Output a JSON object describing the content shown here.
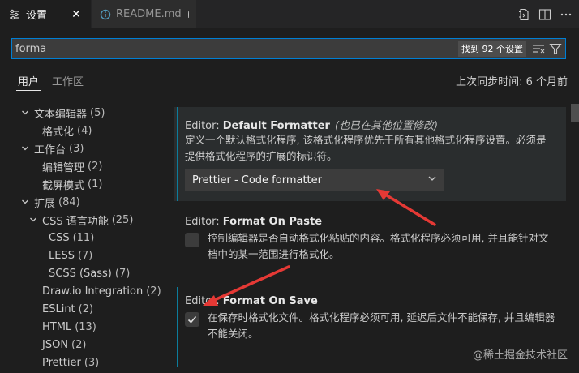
{
  "tabs": [
    {
      "label": "设置",
      "icon": "settings-list-icon",
      "state": "active"
    },
    {
      "label": "README.md",
      "icon": "info-icon",
      "state": "unsaved"
    }
  ],
  "editor_actions": [
    "open-settings-json-icon",
    "split-editor-icon",
    "more-actions-icon"
  ],
  "search": {
    "value": "forma",
    "result_count": "找到 92 个设置",
    "buttons": [
      "clear-filter-icon",
      "filter-icon"
    ]
  },
  "scope": {
    "tabs": [
      "用户",
      "工作区"
    ],
    "active": "用户",
    "sync_status": "上次同步时间: 6 个月前"
  },
  "toc": [
    {
      "label": "文本编辑器",
      "count": "(5)",
      "level": 0,
      "expanded": true
    },
    {
      "label": "格式化",
      "count": "(4)",
      "level": 1
    },
    {
      "label": "工作台",
      "count": "(3)",
      "level": 0,
      "expanded": true
    },
    {
      "label": "编辑管理",
      "count": "(2)",
      "level": 1
    },
    {
      "label": "截屏模式",
      "count": "(1)",
      "level": 1
    },
    {
      "label": "扩展",
      "count": "(84)",
      "level": 0,
      "expanded": true
    },
    {
      "label": "CSS 语言功能",
      "count": "(25)",
      "level": 1,
      "expanded": true
    },
    {
      "label": "CSS",
      "count": "(11)",
      "level": 2
    },
    {
      "label": "LESS",
      "count": "(7)",
      "level": 2
    },
    {
      "label": "SCSS (Sass)",
      "count": "(7)",
      "level": 2
    },
    {
      "label": "Draw.io Integration",
      "count": "(2)",
      "level": 1
    },
    {
      "label": "ESLint",
      "count": "(2)",
      "level": 1
    },
    {
      "label": "HTML",
      "count": "(13)",
      "level": 1
    },
    {
      "label": "JSON",
      "count": "(2)",
      "level": 1
    },
    {
      "label": "Prettier",
      "count": "(3)",
      "level": 1
    }
  ],
  "settings": {
    "default_formatter": {
      "category": "Editor: ",
      "name": "Default Formatter",
      "note": "(也已在其他位置修改)",
      "description": "定义一个默认格式化程序, 该格式化程序优先于所有其他格式化程序设置。必须是提供格式化程序的扩展的标识符。",
      "value": "Prettier - Code formatter"
    },
    "format_on_paste": {
      "category": "Editor: ",
      "name": "Format On Paste",
      "description": "控制编辑器是否自动格式化粘贴的内容。格式化程序必须可用, 并且能针对文档中的某一范围进行格式化。",
      "checked": false
    },
    "format_on_save": {
      "category": "Editor: ",
      "name": "Format On Save",
      "description": "在保存时格式化文件。格式化程序必须可用, 延迟后文件不能保存, 并且编辑器不能关闭。",
      "checked": true
    }
  },
  "annotation_color": "#e53935",
  "watermark": "@稀土掘金技术社区"
}
